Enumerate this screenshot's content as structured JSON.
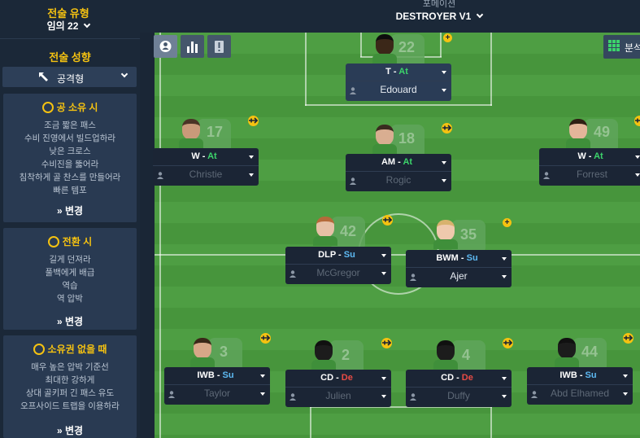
{
  "tactic_style": {
    "label": "전술 유형",
    "value": "임의 22"
  },
  "formation": {
    "label": "포메이션",
    "value": "DESTROYER V1"
  },
  "sidebar": {
    "mentality_label": "전술 성향",
    "mentality_value": "공격형",
    "in_possession": {
      "title": "공 소유 시",
      "lines": [
        "조금 짧은 패스",
        "수비 진영에서 빌드업하라",
        "낮은 크로스",
        "수비진을 뚫어라",
        "침착하게 골 찬스를 만들어라",
        "빠른 템포"
      ],
      "change": "변경"
    },
    "in_transition": {
      "title": "전환 시",
      "lines": [
        "길게 던져라",
        "풀백에게 배급",
        "역습",
        "역 압박"
      ],
      "change": "변경"
    },
    "out_of_possession": {
      "title": "소유권 없을 때",
      "lines": [
        "매우 높은 압박 기준선",
        "최대한 강하게",
        "상대 골키퍼 긴 패스 유도",
        "오프사이드 트랩을 이용하라"
      ],
      "change": "변경"
    }
  },
  "analysis": {
    "label": "분석"
  },
  "colors": {
    "accent": "#f5c211",
    "attack": "#3cd46b",
    "support": "#5db9f2",
    "defend": "#e84b45",
    "pitch": "#4e9e43"
  },
  "players": [
    {
      "id": "st",
      "role": "T",
      "duty": "At",
      "name": "Edouard",
      "number": "22",
      "dim": false
    },
    {
      "id": "wl",
      "role": "W",
      "duty": "At",
      "name": "Christie",
      "number": "17",
      "dim": true
    },
    {
      "id": "am",
      "role": "AM",
      "duty": "At",
      "name": "Rogic",
      "number": "18",
      "dim": true
    },
    {
      "id": "wr",
      "role": "W",
      "duty": "At",
      "name": "Forrest",
      "number": "49",
      "dim": true
    },
    {
      "id": "dlp",
      "role": "DLP",
      "duty": "Su",
      "name": "McGregor",
      "number": "42",
      "dim": true
    },
    {
      "id": "bwm",
      "role": "BWM",
      "duty": "Su",
      "name": "Ajer",
      "number": "35",
      "dim": false
    },
    {
      "id": "iwbl",
      "role": "IWB",
      "duty": "Su",
      "name": "Taylor",
      "number": "3",
      "dim": true
    },
    {
      "id": "cdl",
      "role": "CD",
      "duty": "De",
      "name": "Julien",
      "number": "2",
      "dim": true
    },
    {
      "id": "cdr",
      "role": "CD",
      "duty": "De",
      "name": "Duffy",
      "number": "4",
      "dim": true
    },
    {
      "id": "iwbr",
      "role": "IWB",
      "duty": "Su",
      "name": "Abd Elhamed",
      "number": "44",
      "dim": true
    }
  ],
  "separator": " - "
}
